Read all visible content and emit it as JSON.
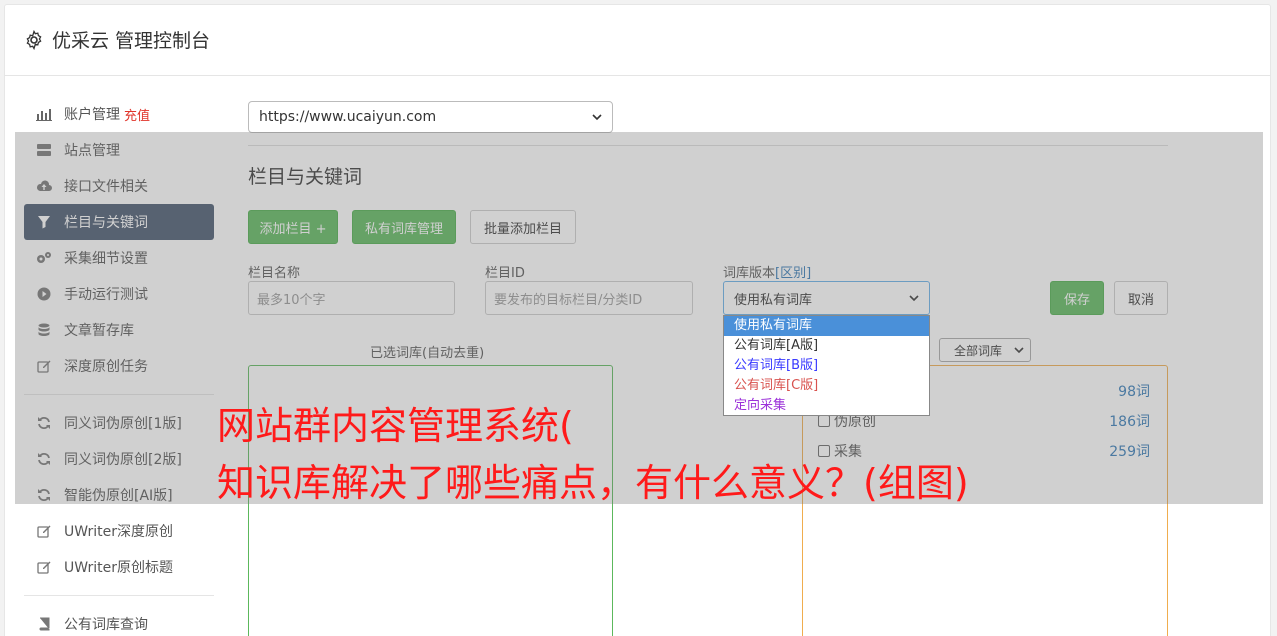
{
  "header": {
    "title": "优采云 管理控制台",
    "icon": "gear-icon"
  },
  "sidebar": {
    "items": [
      {
        "label": "账户管理",
        "extra": "充值",
        "icon": "bar-chart-icon"
      },
      {
        "label": "站点管理",
        "icon": "server-icon"
      },
      {
        "label": "接口文件相关",
        "icon": "cloud-upload-icon"
      },
      {
        "label": "栏目与关键词",
        "icon": "filter-icon",
        "active": true
      },
      {
        "label": "采集细节设置",
        "icon": "cogs-icon"
      },
      {
        "label": "手动运行测试",
        "icon": "play-circle-icon"
      },
      {
        "label": "文章暂存库",
        "icon": "database-icon"
      },
      {
        "label": "深度原创任务",
        "icon": "edit-icon"
      },
      {
        "label": "同义词伪原创[1版]",
        "icon": "refresh-icon"
      },
      {
        "label": "同义词伪原创[2版]",
        "icon": "refresh-icon"
      },
      {
        "label": "智能伪原创[AI版]",
        "icon": "refresh-icon"
      },
      {
        "label": "UWriter深度原创",
        "icon": "edit-icon"
      },
      {
        "label": "UWriter原创标题",
        "icon": "edit-icon"
      },
      {
        "label": "公有词库查询",
        "icon": "book-icon"
      }
    ]
  },
  "site_select": {
    "value": "https://www.ucaiyun.com"
  },
  "main": {
    "title": "栏目与关键词",
    "buttons": {
      "add_column": "添加栏目 +",
      "private_lib": "私有词库管理",
      "batch_add": "批量添加栏目"
    },
    "form": {
      "name_label": "栏目名称",
      "name_placeholder": "最多10个字",
      "id_label": "栏目ID",
      "id_placeholder": "要发布的目标栏目/分类ID",
      "version_label": "词库版本",
      "version_link": "[区别]",
      "version_value": "使用私有词库",
      "save": "保存",
      "cancel": "取消"
    },
    "dropdown_options": [
      {
        "label": "使用私有词库",
        "color": "#ffffff",
        "selected": true
      },
      {
        "label": "公有词库[A版]",
        "color": "#333333"
      },
      {
        "label": "公有词库[B版]",
        "color": "#3a3aff"
      },
      {
        "label": "公有词库[C版]",
        "color": "#d9534f"
      },
      {
        "label": "定向采集",
        "color": "#9b30d9"
      }
    ],
    "selected_panel_title": "已选词库(自动去重)",
    "all_lib_select": "全部词库",
    "libraries": [
      {
        "name": "",
        "count": "98词"
      },
      {
        "name": "伪原创",
        "count": "186词"
      },
      {
        "name": "采集",
        "count": "259词"
      }
    ]
  },
  "overlay_text": {
    "line1": "网站群内容管理系统(",
    "line2": "知识库解决了哪些痛点，有什么意义？(组图)"
  }
}
